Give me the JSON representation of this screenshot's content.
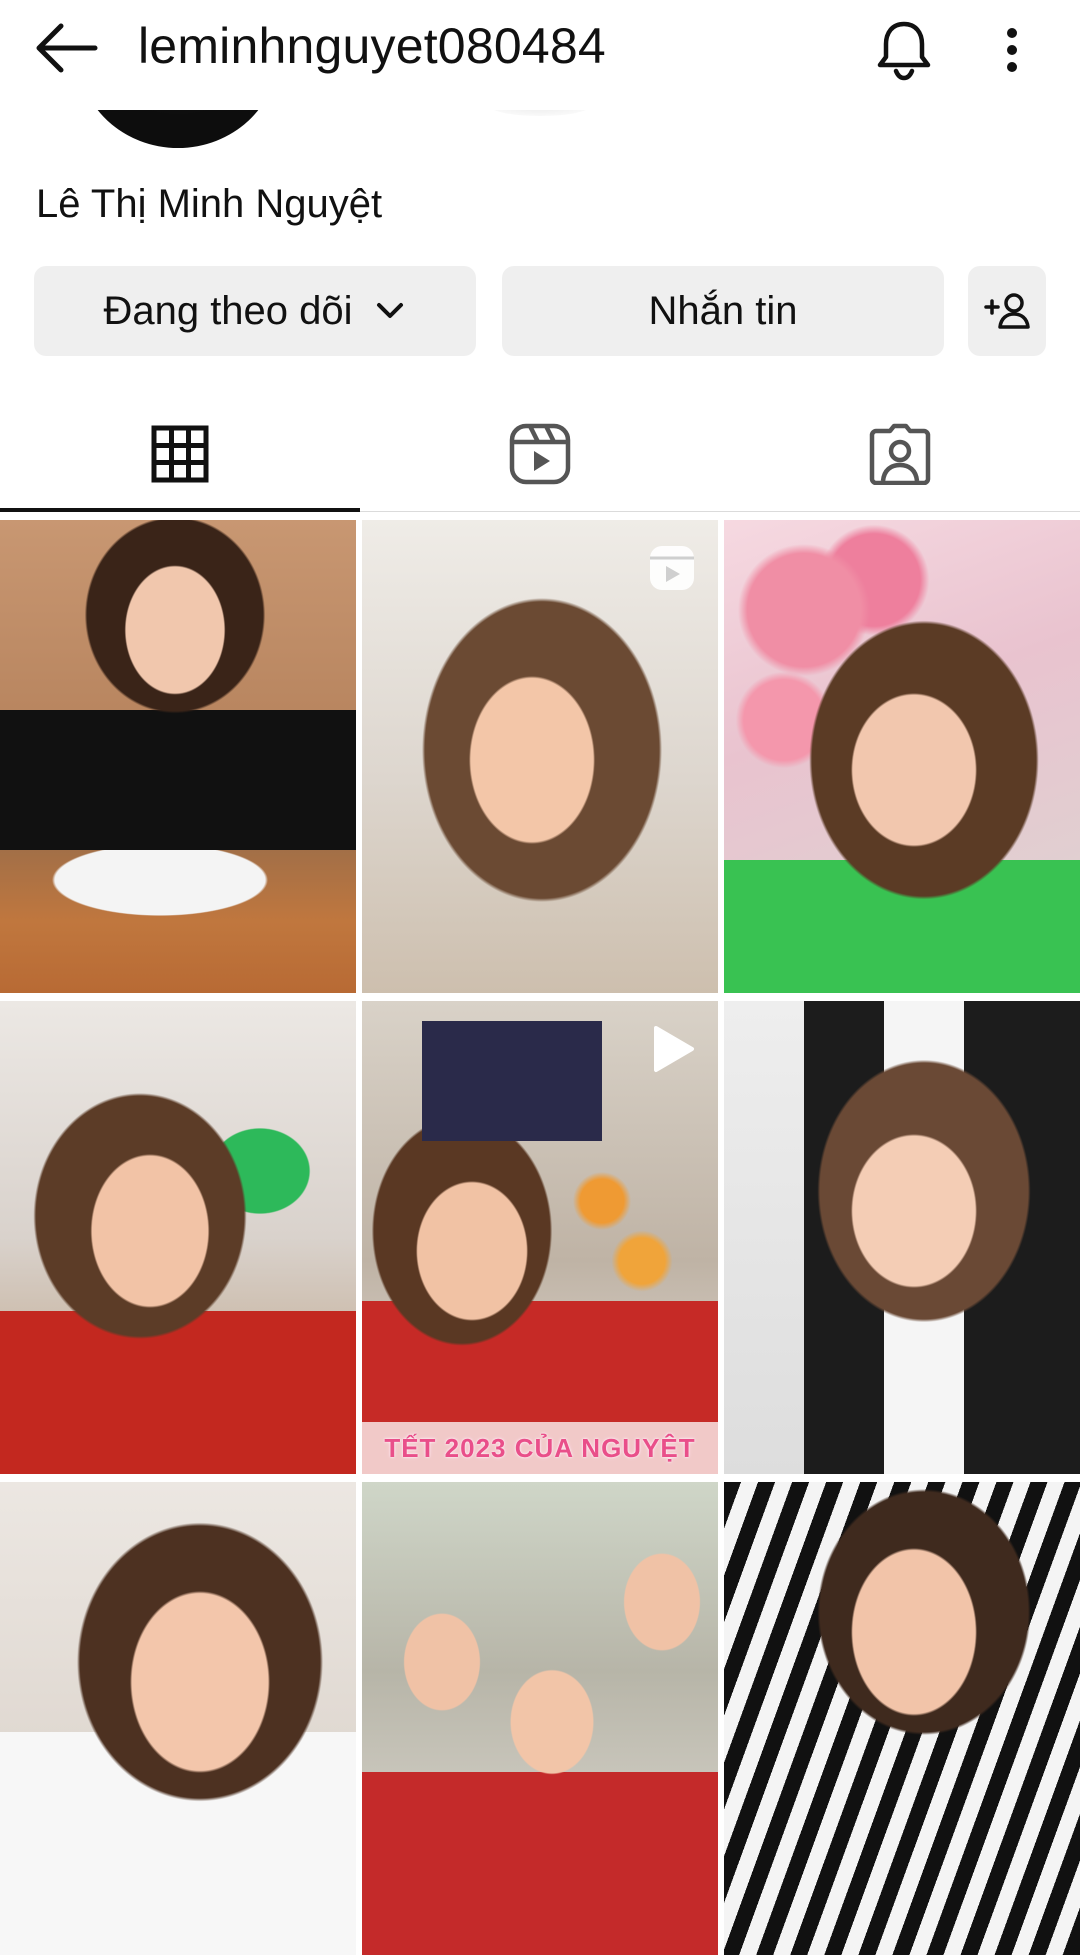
{
  "header": {
    "username": "leminhnguyet080484",
    "back_icon": "arrow-left-icon",
    "bell_icon": "bell-icon",
    "more_icon": "more-vertical-icon"
  },
  "profile": {
    "full_name": "Lê Thị Minh Nguyệt"
  },
  "actions": {
    "following_label": "Đang theo dõi",
    "message_label": "Nhắn tin",
    "suggest_icon": "add-person-icon"
  },
  "tabs": [
    {
      "name": "posts",
      "icon": "grid-icon",
      "active": true
    },
    {
      "name": "reels",
      "icon": "reels-icon",
      "active": false
    },
    {
      "name": "tagged",
      "icon": "tagged-person-icon",
      "active": false
    }
  ],
  "grid": {
    "posts": [
      {
        "id": "post-1",
        "type": "photo"
      },
      {
        "id": "post-2",
        "type": "reel",
        "badge_icon": "reels-badge-icon"
      },
      {
        "id": "post-3",
        "type": "photo"
      },
      {
        "id": "post-4",
        "type": "photo"
      },
      {
        "id": "post-5",
        "type": "video",
        "badge_icon": "play-icon",
        "caption": "TẾT 2023 CỦA NGUYỆT"
      },
      {
        "id": "post-6",
        "type": "photo"
      },
      {
        "id": "post-7",
        "type": "photo"
      },
      {
        "id": "post-8",
        "type": "photo"
      },
      {
        "id": "post-9",
        "type": "photo"
      }
    ]
  },
  "colors": {
    "button_bg": "#efefef",
    "text": "#111111",
    "divider": "#dbdbdb",
    "caption_pink": "#e94f8a"
  }
}
